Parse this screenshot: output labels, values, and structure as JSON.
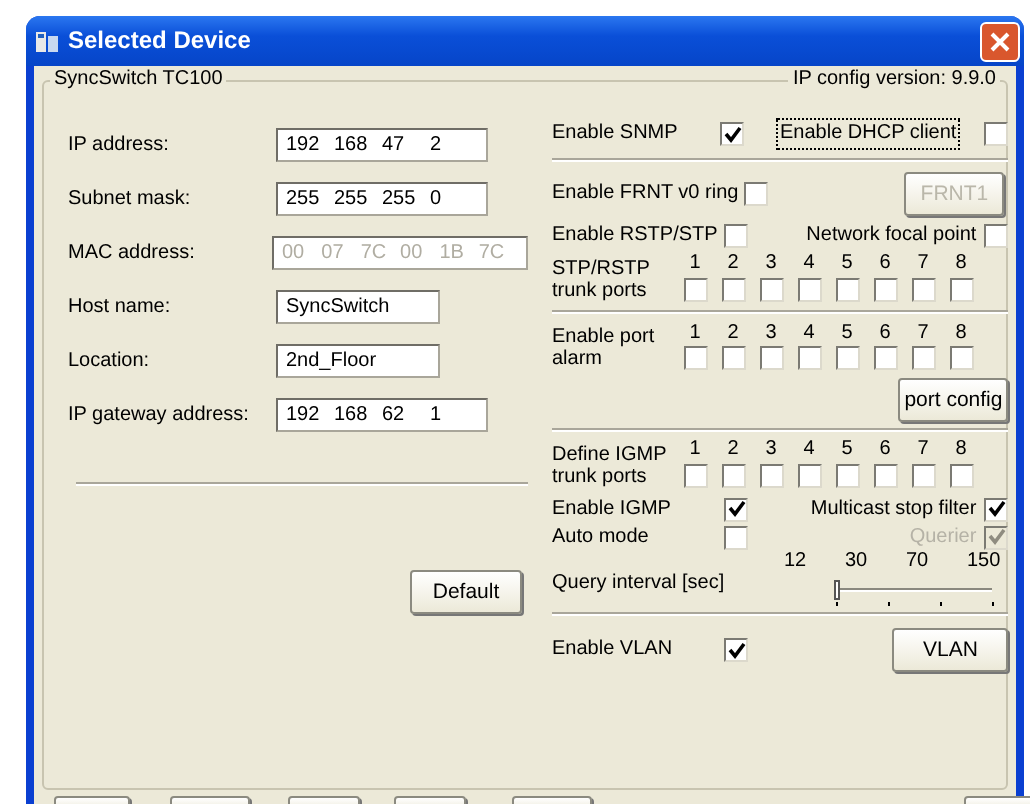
{
  "window": {
    "title": "Selected Device"
  },
  "group": {
    "title": "SyncSwitch TC100",
    "version": "IP config version: 9.9.0"
  },
  "fields": [
    {
      "label": "IP address:",
      "kind": "octets",
      "values": [
        "192",
        "168",
        "47",
        "2"
      ],
      "disabled": false
    },
    {
      "label": "Subnet mask:",
      "kind": "octets",
      "values": [
        "255",
        "255",
        "255",
        "0"
      ],
      "disabled": false
    },
    {
      "label": "MAC address:",
      "kind": "octets",
      "values": [
        "00",
        "07",
        "7C",
        "00",
        "1B",
        "7C"
      ],
      "disabled": true
    },
    {
      "label": "Host name:",
      "kind": "text",
      "value": "SyncSwitch",
      "disabled": false
    },
    {
      "label": "Location:",
      "kind": "text",
      "value": "2nd_Floor",
      "disabled": false
    },
    {
      "label": "IP gateway address:",
      "kind": "octets",
      "values": [
        "192",
        "168",
        "62",
        "1"
      ],
      "disabled": false
    }
  ],
  "default_button": {
    "label": "Default"
  },
  "snmp": {
    "label": "Enable SNMP",
    "checked": true
  },
  "dhcp": {
    "label": "Enable DHCP client",
    "checked": false,
    "focused": true
  },
  "frnt": {
    "label": "Enable FRNT v0 ring",
    "checked": false
  },
  "frnt_button": {
    "label": "FRNT1",
    "disabled": true
  },
  "rstp": {
    "label": "Enable RSTP/STP",
    "checked": false
  },
  "focal": {
    "label": "Network focal point",
    "checked": false
  },
  "stp_ports": {
    "label": "STP/RSTP trunk ports",
    "ports": [
      {
        "number": "1",
        "checked": false
      },
      {
        "number": "2",
        "checked": false
      },
      {
        "number": "3",
        "checked": false
      },
      {
        "number": "4",
        "checked": false
      },
      {
        "number": "5",
        "checked": false
      },
      {
        "number": "6",
        "checked": false
      },
      {
        "number": "7",
        "checked": false
      },
      {
        "number": "8",
        "checked": false
      }
    ]
  },
  "alarm_ports": {
    "label": "Enable port alarm",
    "ports": [
      {
        "number": "1",
        "checked": false
      },
      {
        "number": "2",
        "checked": false
      },
      {
        "number": "3",
        "checked": false
      },
      {
        "number": "4",
        "checked": false
      },
      {
        "number": "5",
        "checked": false
      },
      {
        "number": "6",
        "checked": false
      },
      {
        "number": "7",
        "checked": false
      },
      {
        "number": "8",
        "checked": false
      }
    ]
  },
  "port_config_button": "port config",
  "igmp_ports": {
    "label": "Define IGMP trunk ports",
    "ports": [
      {
        "number": "1",
        "checked": false
      },
      {
        "number": "2",
        "checked": false
      },
      {
        "number": "3",
        "checked": false
      },
      {
        "number": "4",
        "checked": false
      },
      {
        "number": "5",
        "checked": false
      },
      {
        "number": "6",
        "checked": false
      },
      {
        "number": "7",
        "checked": false
      },
      {
        "number": "8",
        "checked": false
      }
    ]
  },
  "igmp": {
    "label": "Enable IGMP",
    "checked": true
  },
  "multicast": {
    "label": "Multicast stop filter",
    "checked": true
  },
  "auto": {
    "label": "Auto mode",
    "checked": false
  },
  "querier": {
    "label": "Querier",
    "checked": true,
    "disabled": true
  },
  "query": {
    "label": "Query interval [sec]",
    "ticks": [
      "12",
      "30",
      "70",
      "150"
    ],
    "level": 0
  },
  "vlan": {
    "label": "Enable VLAN",
    "checked": true
  },
  "vlan_button": "VLAN"
}
